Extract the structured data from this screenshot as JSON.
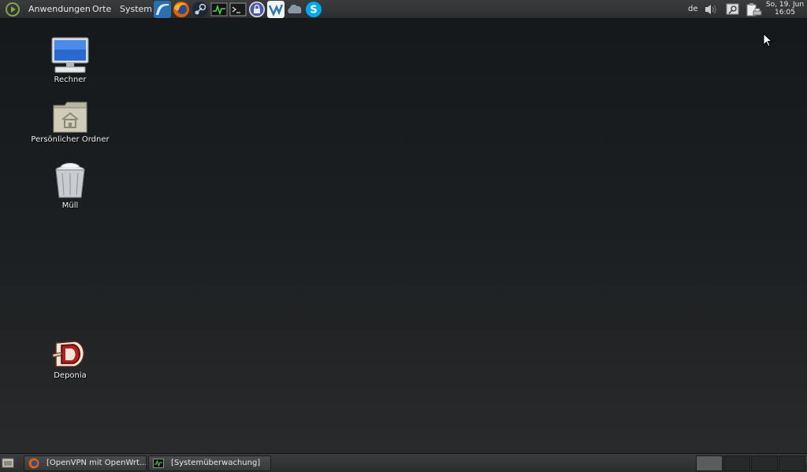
{
  "top_panel": {
    "menus": [
      {
        "label": "Anwendungen"
      },
      {
        "label": "Orte"
      },
      {
        "label": "System"
      }
    ],
    "launchers": [
      {
        "name": "wireshark-icon",
        "color": "#2a6fb0"
      },
      {
        "name": "firefox-icon",
        "color": "#e66000"
      },
      {
        "name": "steam-icon",
        "color": "#2a3f5a"
      },
      {
        "name": "system-monitor-icon",
        "color": "#2b2b2b"
      },
      {
        "name": "terminal-icon",
        "color": "#222222"
      },
      {
        "name": "keepass-lock-icon",
        "color": "#5a6bb0"
      },
      {
        "name": "vlc-icon",
        "color": "#2b2b2b"
      },
      {
        "name": "cloud-icon",
        "color": "#8a99a8"
      },
      {
        "name": "skype-icon",
        "color": "#00a9e8"
      }
    ],
    "tray": {
      "keyboard_layout": "de",
      "clock_date": "So, 19. Jun",
      "clock_time": "16:05"
    }
  },
  "desktop": {
    "icons": [
      {
        "label": "Rechner",
        "icon": "computer-icon"
      },
      {
        "label": "Persönlicher Ordner",
        "icon": "home-folder-icon"
      },
      {
        "label": "Müll",
        "icon": "trash-icon"
      },
      {
        "label": "Deponia",
        "icon": "deponia-icon"
      }
    ]
  },
  "bottom_panel": {
    "tasks": [
      {
        "label": "[OpenVPN mit OpenWrt...",
        "icon": "firefox-icon"
      },
      {
        "label": "[Systemüberwachung]",
        "icon": "system-monitor-icon"
      }
    ],
    "workspaces": 4
  }
}
